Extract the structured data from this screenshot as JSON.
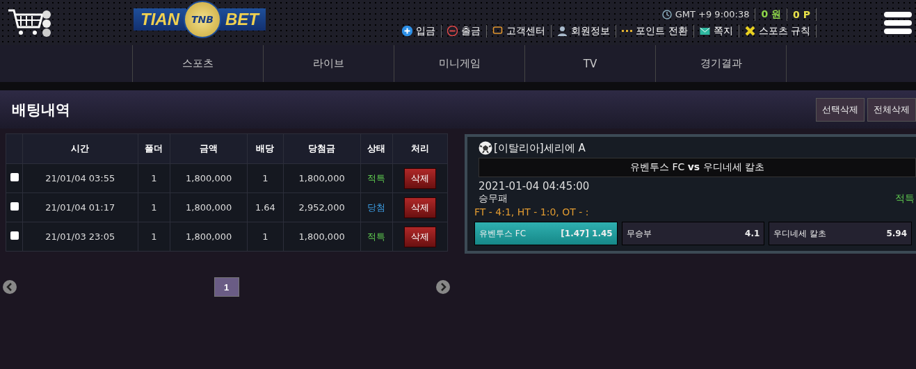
{
  "logo": {
    "left": "TIAN",
    "monogram": "TNB",
    "right": "BET"
  },
  "clock": "GMT +9 9:00:38",
  "money": "0 원",
  "points": "0 P",
  "header_links": [
    {
      "kind": "deposit",
      "label": "입금"
    },
    {
      "kind": "withdraw",
      "label": "출금"
    },
    {
      "kind": "support",
      "label": "고객센터"
    },
    {
      "kind": "member",
      "label": "회원정보"
    },
    {
      "kind": "points",
      "label": "포인트 전환"
    },
    {
      "kind": "message",
      "label": "쪽지"
    },
    {
      "kind": "rules",
      "label": "스포츠 규칙"
    }
  ],
  "nav": [
    "스포츠",
    "라이브",
    "미니게임",
    "TV",
    "경기결과"
  ],
  "page_title": "배팅내역",
  "actions": [
    "선택삭제",
    "전체삭제"
  ],
  "table": {
    "columns": [
      "시간",
      "폴더",
      "금액",
      "배당",
      "당첨금",
      "상태",
      "처리"
    ],
    "rows": [
      {
        "checked": false,
        "time": "21/01/04 03:55",
        "folder": "1",
        "amount": "1,800,000",
        "odds": "1",
        "payout": "1,800,000",
        "status": "적특",
        "color": "#5fc94f",
        "action": "삭제"
      },
      {
        "checked": false,
        "time": "21/01/04 01:17",
        "folder": "1",
        "amount": "1,800,000",
        "odds": "1.64",
        "payout": "2,952,000",
        "status": "당첨",
        "color": "#3b9be0",
        "action": "삭제"
      },
      {
        "checked": false,
        "time": "21/01/03 23:05",
        "folder": "1",
        "amount": "1,800,000",
        "odds": "1",
        "payout": "1,800,000",
        "status": "적특",
        "color": "#5fc94f",
        "action": "삭제"
      }
    ]
  },
  "pagination": {
    "pages": [
      {
        "label": "1",
        "selected": true
      }
    ]
  },
  "bet_detail": {
    "league": "[이탈리아]세리에 A",
    "home": "유벤투스 FC",
    "vs": "vs",
    "away": "우디네세 칼초",
    "datetime": "2021-01-04 04:45:00",
    "market": "승무패",
    "result": "적특",
    "score": "FT - 4:1, HT - 1:0, OT - :",
    "options": [
      {
        "label": "유벤투스 FC",
        "odds": "[1.47] 1.45",
        "selected": true
      },
      {
        "label": "무승부",
        "odds": "4.1",
        "selected": false
      },
      {
        "label": "우디네세 칼초",
        "odds": "5.94",
        "selected": false
      }
    ]
  }
}
